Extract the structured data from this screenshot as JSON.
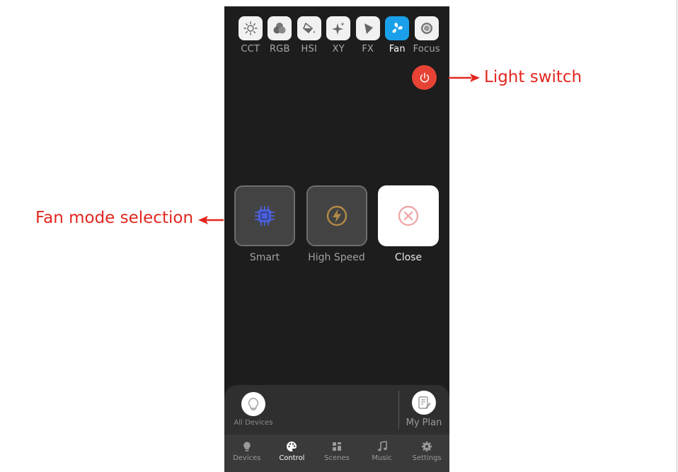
{
  "mode_tabs": [
    {
      "label": "CCT",
      "icon": "sun-icon"
    },
    {
      "label": "RGB",
      "icon": "color-circles-icon"
    },
    {
      "label": "HSI",
      "icon": "paint-bucket-icon"
    },
    {
      "label": "XY",
      "icon": "sparkle-icon"
    },
    {
      "label": "FX",
      "icon": "fx-triangle-icon"
    },
    {
      "label": "Fan",
      "icon": "fan-icon",
      "active": true
    },
    {
      "label": "Focus",
      "icon": "focus-ring-icon"
    }
  ],
  "fan_modes": [
    {
      "label": "Smart",
      "icon": "chip-icon"
    },
    {
      "label": "High Speed",
      "icon": "lightning-icon"
    },
    {
      "label": "Close",
      "icon": "close-circle-icon",
      "selected": true
    }
  ],
  "bottom_panel": {
    "all_devices_label": "All Devices",
    "my_plan_label": "My Plan"
  },
  "tab_bar": [
    {
      "label": "Devices",
      "icon": "bulb-icon"
    },
    {
      "label": "Control",
      "icon": "palette-icon",
      "active": true
    },
    {
      "label": "Scenes",
      "icon": "grid-icon"
    },
    {
      "label": "Music",
      "icon": "music-note-icon"
    },
    {
      "label": "Settings",
      "icon": "gear-icon"
    }
  ],
  "annotations": {
    "light_switch": "Light switch",
    "fan_mode_selection": "Fan mode selection"
  },
  "colors": {
    "active_blue": "#1aa0ea",
    "power_red": "#e74335",
    "annotation_red": "#e3261f",
    "background": "#1d1d1d"
  }
}
